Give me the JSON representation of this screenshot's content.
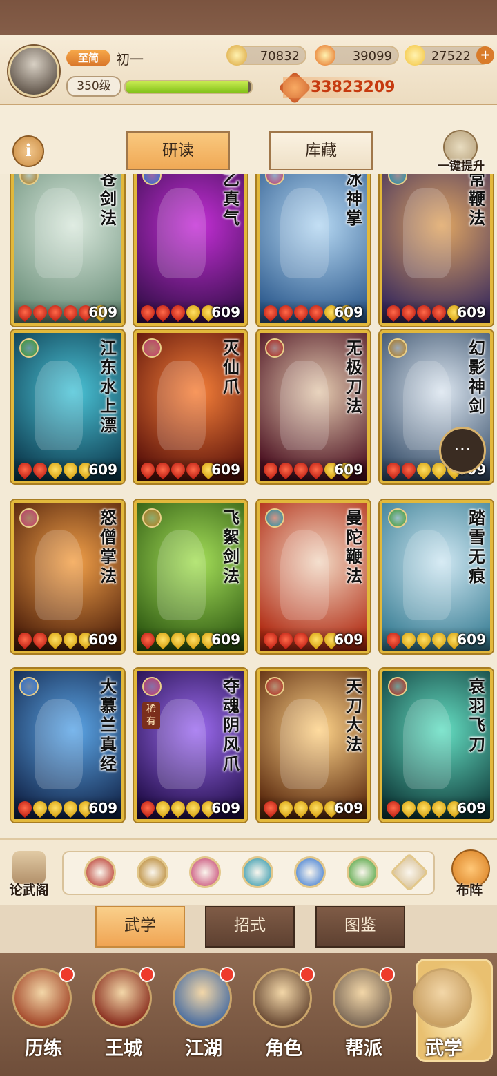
{
  "player": {
    "rank_badge": "至简",
    "name": "初一",
    "level": "350级",
    "exp_fraction": 0.98,
    "power": "33823209"
  },
  "resources": [
    {
      "name": "copper",
      "value": "70832",
      "icon": "coin-icon",
      "color": "#d9a23a"
    },
    {
      "name": "fire",
      "value": "39099",
      "icon": "fire-orb-icon",
      "color": "#e46a1e"
    },
    {
      "name": "ingot",
      "value": "27522",
      "icon": "gold-ingot-icon",
      "color": "#f3c23b"
    }
  ],
  "tabs": {
    "info": "i",
    "study": "研读",
    "collection": "库藏",
    "upgrade_all": "一键提升"
  },
  "cards": [
    {
      "title": "寒苍剑法",
      "school": "sword",
      "level": "609",
      "red": 5,
      "gold": 1,
      "palette": [
        "#d9e8dc",
        "#6b8f7a"
      ]
    },
    {
      "title": "太乙真气",
      "school": "yinyang",
      "level": "609",
      "red": 3,
      "gold": 2,
      "palette": [
        "#c42fd6",
        "#3a0f4f"
      ]
    },
    {
      "title": "寒冰神掌",
      "school": "palm",
      "level": "609",
      "red": 4,
      "gold": 2,
      "palette": [
        "#b6d8f2",
        "#2f5c8f"
      ]
    },
    {
      "title": "无常鞭法",
      "school": "fan",
      "level": "609",
      "red": 4,
      "gold": 1,
      "palette": [
        "#e0a663",
        "#3a2b5c"
      ]
    },
    {
      "title": "江东水上漂",
      "school": "step",
      "level": "609",
      "red": 2,
      "gold": 3,
      "palette": [
        "#4cc5d8",
        "#0d3b4f"
      ]
    },
    {
      "title": "灭仙爪",
      "school": "palm",
      "level": "609",
      "red": 4,
      "gold": 1,
      "palette": [
        "#f7813a",
        "#5b120a"
      ]
    },
    {
      "title": "无极刀法",
      "school": "blade",
      "level": "609",
      "red": 4,
      "gold": 2,
      "palette": [
        "#e4cbb0",
        "#4a0f20"
      ]
    },
    {
      "title": "幻影神剑",
      "school": "sword",
      "level": "609",
      "red": 2,
      "gold": 3,
      "palette": [
        "#dce6f0",
        "#39506b"
      ]
    },
    {
      "title": "怒僧掌法",
      "school": "palm",
      "level": "609",
      "red": 2,
      "gold": 3,
      "palette": [
        "#f4a24a",
        "#4d1f0a"
      ]
    },
    {
      "title": "飞絮剑法",
      "school": "sword",
      "level": "609",
      "red": 1,
      "gold": 4,
      "palette": [
        "#a6e05a",
        "#2f5a12"
      ]
    },
    {
      "title": "曼陀鞭法",
      "school": "fan",
      "level": "609",
      "red": 3,
      "gold": 2,
      "palette": [
        "#f2d9c4",
        "#b02a12"
      ]
    },
    {
      "title": "踏雪无痕",
      "school": "step",
      "level": "609",
      "red": 1,
      "gold": 4,
      "palette": [
        "#cfe7f2",
        "#3b7f95"
      ]
    },
    {
      "title": "大慕兰真经",
      "school": "yinyang",
      "level": "609",
      "red": 1,
      "gold": 4,
      "palette": [
        "#5da7e8",
        "#12254a"
      ]
    },
    {
      "title": "夺魂阴风爪",
      "school": "palm",
      "level": "609",
      "red": 1,
      "gold": 4,
      "palette": [
        "#9d6cf0",
        "#220e4a"
      ],
      "rare": "稀有"
    },
    {
      "title": "天刀大法",
      "school": "blade",
      "level": "609",
      "red": 1,
      "gold": 4,
      "palette": [
        "#ffd48a",
        "#5b2a0e"
      ]
    },
    {
      "title": "哀羽飞刀",
      "school": "blade",
      "level": "609",
      "red": 1,
      "gold": 4,
      "palette": [
        "#66e0c4",
        "#0f3b3a"
      ]
    }
  ],
  "school_colors": {
    "sword": "#b07a1c",
    "yinyang": "#2b6fcf",
    "palm": "#c23a6a",
    "fan": "#1f8fa6",
    "step": "#3f9a2c",
    "blade": "#b2271b"
  },
  "filters": [
    {
      "icon": "blade-school-icon",
      "color": "#b2271b"
    },
    {
      "icon": "sword-school-icon",
      "color": "#b07a1c"
    },
    {
      "icon": "palm-school-icon",
      "color": "#c23a6a"
    },
    {
      "icon": "fan-school-icon",
      "color": "#1f8fa6"
    },
    {
      "icon": "yinyang-school-icon",
      "color": "#2b6fcf"
    },
    {
      "icon": "step-school-icon",
      "color": "#3f9a2c"
    },
    {
      "icon": "chevron-up-school-icon",
      "color": "#d9c39a"
    }
  ],
  "side_buttons": {
    "forum": "论武阁",
    "formation": "布阵"
  },
  "subtabs": {
    "martial": "武学",
    "moves": "招式",
    "atlas": "图鉴"
  },
  "nav": [
    {
      "label": "历练",
      "badge": true,
      "color": "#a44a2c"
    },
    {
      "label": "王城",
      "badge": true,
      "color": "#8a3020"
    },
    {
      "label": "江湖",
      "badge": true,
      "color": "#4d6fa0"
    },
    {
      "label": "角色",
      "badge": true,
      "color": "#6b4c36"
    },
    {
      "label": "帮派",
      "badge": true,
      "color": "#7d6a58"
    },
    {
      "label": "武学",
      "badge": false,
      "color": "#c9a063"
    }
  ]
}
